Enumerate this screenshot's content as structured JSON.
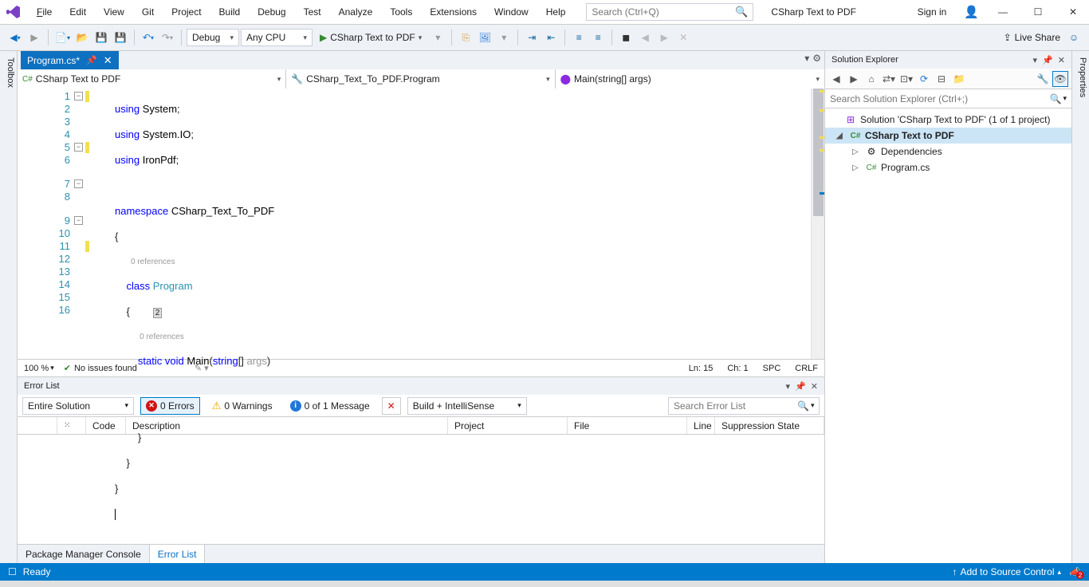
{
  "menu": {
    "items": [
      "File",
      "Edit",
      "View",
      "Git",
      "Project",
      "Build",
      "Debug",
      "Test",
      "Analyze",
      "Tools",
      "Extensions",
      "Window",
      "Help"
    ]
  },
  "search": {
    "placeholder": "Search (Ctrl+Q)"
  },
  "title": "CSharp Text to PDF",
  "signin": "Sign in",
  "toolbar": {
    "config": "Debug",
    "platform": "Any CPU",
    "run_label": "CSharp Text to PDF",
    "live_share": "Live Share"
  },
  "side_left": "Toolbox",
  "side_right": "Properties",
  "doc_tab": {
    "name": "Program.cs*"
  },
  "nav": {
    "project": "CSharp Text to PDF",
    "class": "CSharp_Text_To_PDF.Program",
    "member": "Main(string[] args)"
  },
  "code": {
    "lines": [
      "1",
      "2",
      "3",
      "4",
      "5",
      "6",
      "7",
      "8",
      "9",
      "10",
      "11",
      "12",
      "13",
      "14",
      "15",
      "16"
    ],
    "ref_label": "0 references",
    "t_using": "using",
    "t_system": "System",
    "t_systemio": "System.IO",
    "t_ironpdf": "IronPdf",
    "t_namespace": "namespace",
    "t_ns_name": "CSharp_Text_To_PDF",
    "t_class": "class",
    "t_program": "Program",
    "t_static": "static",
    "t_void": "void",
    "t_main": "Main",
    "t_string": "string",
    "t_args": "args",
    "t_obr": "{",
    "t_cbr": "}",
    "t_par": "[] ",
    "t_semi": ";"
  },
  "editor_status": {
    "zoom": "100 %",
    "issues": "No issues found",
    "ln": "Ln: 15",
    "ch": "Ch: 1",
    "spc": "SPC",
    "crlf": "CRLF"
  },
  "errorlist": {
    "title": "Error List",
    "scope": "Entire Solution",
    "errors": "0 Errors",
    "warnings": "0 Warnings",
    "messages": "0 of 1 Message",
    "filter": "Build + IntelliSense",
    "search_placeholder": "Search Error List",
    "cols": [
      "",
      "Code",
      "Description",
      "Project",
      "File",
      "Line",
      "Suppression State"
    ]
  },
  "bottom_tabs": {
    "pmc": "Package Manager Console",
    "el": "Error List"
  },
  "solexp": {
    "title": "Solution Explorer",
    "search_placeholder": "Search Solution Explorer (Ctrl+;)",
    "solution": "Solution 'CSharp Text to PDF' (1 of 1 project)",
    "project": "CSharp Text to PDF",
    "deps": "Dependencies",
    "program": "Program.cs"
  },
  "app_status": {
    "ready": "Ready",
    "source_control": "Add to Source Control",
    "notif_count": "2"
  }
}
